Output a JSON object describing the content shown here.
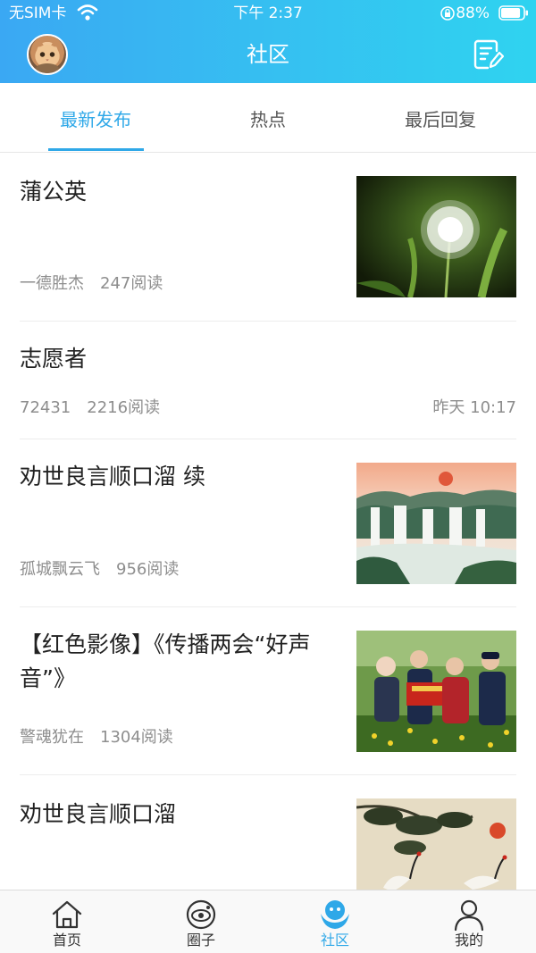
{
  "status_bar": {
    "carrier": "无SIM卡",
    "time": "下午 2:37",
    "battery": "88%",
    "battery_level": 0.88
  },
  "nav": {
    "title": "社区"
  },
  "tabs": [
    {
      "label": "最新发布",
      "selected": true
    },
    {
      "label": "热点",
      "selected": false
    },
    {
      "label": "最后回复",
      "selected": false
    }
  ],
  "posts": [
    {
      "title": "蒲公英",
      "author": "一德胜杰",
      "reads": "247阅读",
      "time": "",
      "thumbnail": "dandelion-photo"
    },
    {
      "title": "志愿者",
      "author": "72431",
      "reads": "2216阅读",
      "time": "昨天 10:17",
      "thumbnail": ""
    },
    {
      "title": "劝世良言顺口溜 续",
      "author": "孤城飘云飞",
      "reads": "956阅读",
      "time": "",
      "thumbnail": "waterfall-painting"
    },
    {
      "title": "【红色影像】《传播两会“好声音”》",
      "author": "警魂犹在",
      "reads": "1304阅读",
      "time": "",
      "thumbnail": "police-volunteers-photo"
    },
    {
      "title": "劝世良言顺口溜",
      "author": "",
      "reads": "",
      "time": "",
      "thumbnail": "cranes-painting"
    }
  ],
  "tabbar": [
    {
      "label": "首页",
      "icon": "home-icon",
      "selected": false
    },
    {
      "label": "圈子",
      "icon": "circle-icon",
      "selected": false
    },
    {
      "label": "社区",
      "icon": "community-icon",
      "selected": true
    },
    {
      "label": "我的",
      "icon": "profile-icon",
      "selected": false
    }
  ],
  "colors": {
    "accent": "#2fa8e8",
    "header_gradient_start": "#3aa8f3",
    "header_gradient_end": "#2fd3f0"
  }
}
